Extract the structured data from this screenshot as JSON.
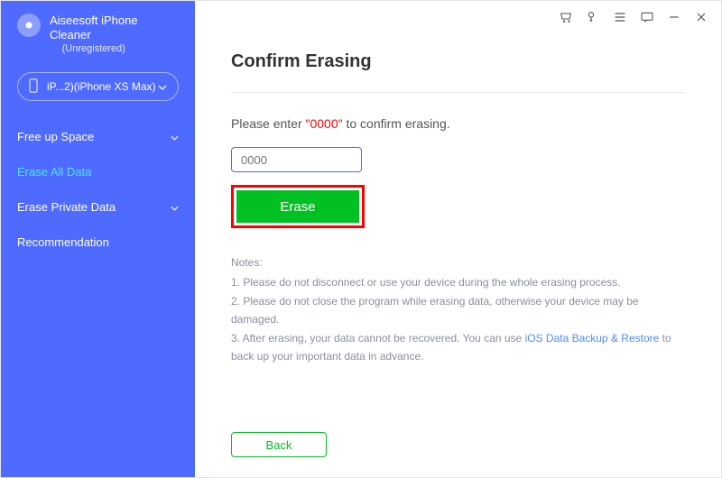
{
  "brand": {
    "line1": "Aiseesoft iPhone",
    "line2": "Cleaner",
    "status": "(Unregistered)"
  },
  "device": {
    "label": "iP...2)(iPhone XS Max)"
  },
  "sidebar": {
    "items": [
      {
        "label": "Free up Space"
      },
      {
        "label": "Erase All Data"
      },
      {
        "label": "Erase Private Data"
      },
      {
        "label": "Recommendation"
      }
    ]
  },
  "main": {
    "title": "Confirm Erasing",
    "prompt_pre": "Please enter ",
    "prompt_code": "\"0000\"",
    "prompt_post": " to confirm erasing.",
    "input_placeholder": "0000",
    "erase_label": "Erase",
    "back_label": "Back"
  },
  "notes": {
    "header": "Notes:",
    "n1": "1. Please do not disconnect or use your device during the whole erasing process.",
    "n2": "2. Please do not close the program while erasing data, otherwise your device may be damaged.",
    "n3_pre": "3. After erasing, your data cannot be recovered. You can use ",
    "n3_link": "iOS Data Backup & Restore",
    "n3_post": " to back up your important data in advance."
  }
}
